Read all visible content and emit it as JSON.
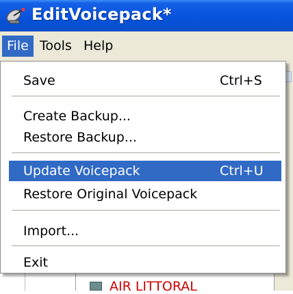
{
  "window": {
    "title": "EditVoicepack*"
  },
  "menubar": {
    "items": [
      "File",
      "Tools",
      "Help"
    ]
  },
  "file_menu": {
    "save": {
      "label": "Save",
      "shortcut": "Ctrl+S"
    },
    "create_backup": {
      "label": "Create Backup..."
    },
    "restore_backup": {
      "label": "Restore Backup..."
    },
    "update_voicepack": {
      "label": "Update Voicepack",
      "shortcut": "Ctrl+U"
    },
    "restore_original": {
      "label": "Restore Original Voicepack"
    },
    "import": {
      "label": "Import..."
    },
    "exit": {
      "label": "Exit"
    }
  },
  "background": {
    "tree_item_label": "AIR LITTORAL"
  },
  "colors": {
    "titlebar": "#0a55df",
    "menu_highlight": "#316ac5",
    "menubar_bg": "#ece9d8",
    "tree_label": "#cc0000"
  },
  "icons": {
    "app": "satellite-dish-icon"
  }
}
